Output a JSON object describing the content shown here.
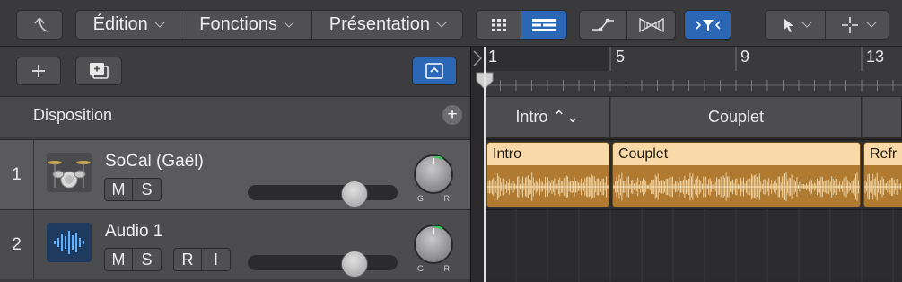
{
  "toolbar": {
    "menus": [
      {
        "label": "Édition"
      },
      {
        "label": "Fonctions"
      },
      {
        "label": "Présentation"
      }
    ]
  },
  "header": {
    "section_label": "Disposition"
  },
  "ruler": {
    "bars": [
      "1",
      "5",
      "9",
      "13"
    ]
  },
  "markers": [
    {
      "label": "Intro ⌃⌄"
    },
    {
      "label": "Couplet"
    }
  ],
  "tracks": [
    {
      "number": "1",
      "name": "SoCal (Gaël)",
      "buttons": [
        "M",
        "S"
      ],
      "icon": "drum-kit-icon",
      "knob_labels": [
        "G",
        "R"
      ]
    },
    {
      "number": "2",
      "name": "Audio 1",
      "buttons": [
        "M",
        "S",
        "R",
        "I"
      ],
      "icon": "waveform-icon",
      "knob_labels": [
        "G",
        "R"
      ]
    }
  ],
  "regions": [
    {
      "label": "Intro"
    },
    {
      "label": "Couplet"
    },
    {
      "label": "Refr"
    }
  ],
  "colors": {
    "accent": "#2b67b4",
    "region": "#f5d29b",
    "region_wave": "#b07a30"
  }
}
